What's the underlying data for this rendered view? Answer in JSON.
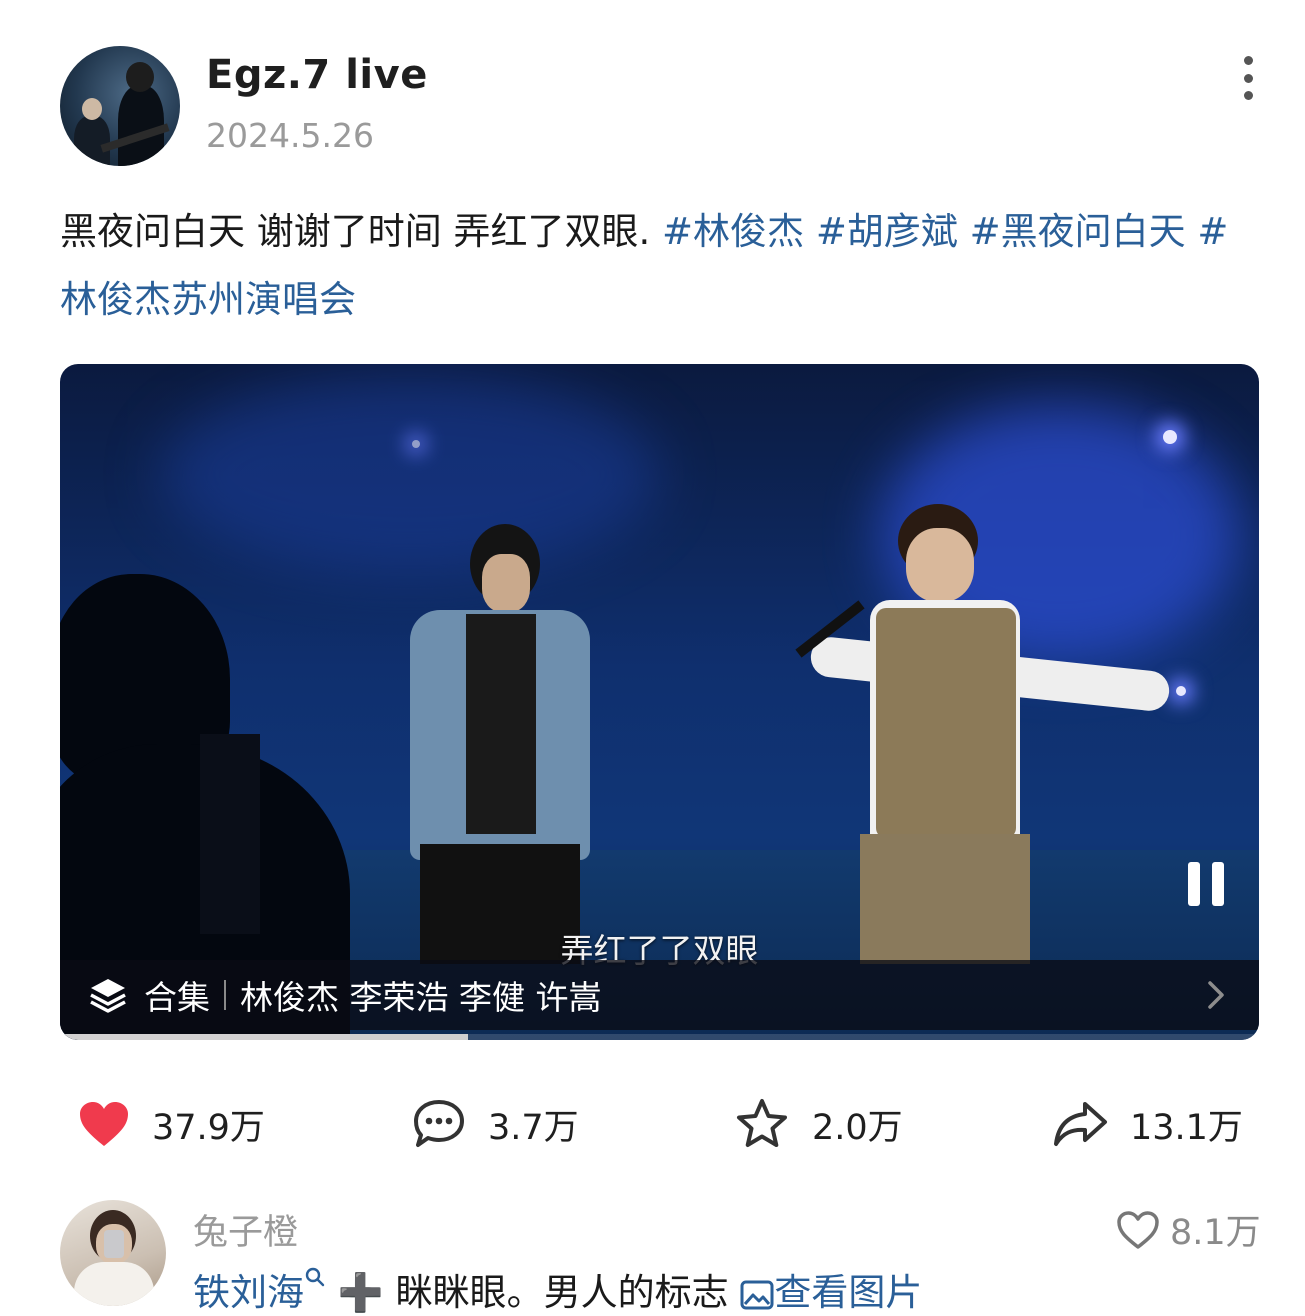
{
  "post": {
    "author": "Egz.7 live",
    "date": "2024.5.26",
    "caption_text": "黑夜问白天 谢谢了时间 弄红了双眼. ",
    "hashtags": [
      "#林俊杰",
      "#胡彦斌",
      "#黑夜问白天",
      "#林俊杰苏州演唱会"
    ]
  },
  "video": {
    "subtitle": "弄红了了双眼",
    "collection_label": "合集",
    "collection_title": "林俊杰 李荣浩 李健 许嵩",
    "progress": 0.34,
    "state": "playing"
  },
  "stats": {
    "likes": "37.9万",
    "comments": "3.7万",
    "favorites": "2.0万",
    "shares": "13.1万"
  },
  "icons": {
    "like": "heart-filled-icon",
    "comment": "comment-bubble-icon",
    "favorite": "star-outline-icon",
    "share": "share-arrow-icon",
    "more": "more-vertical-icon",
    "pause": "pause-icon",
    "collection": "layers-icon",
    "chevron": "chevron-right-icon",
    "comment_like": "heart-outline-icon",
    "search_hint": "search-icon",
    "image_link": "image-icon"
  },
  "colors": {
    "accent_link": "#2a5f98",
    "like_red": "#f03a4d"
  },
  "comment": {
    "author": "兔子橙",
    "like_count": "8.1万",
    "mention": "铁刘海",
    "plus": "➕",
    "text": " 眯眯眼。男人的标志",
    "view_image": "查看图片"
  }
}
